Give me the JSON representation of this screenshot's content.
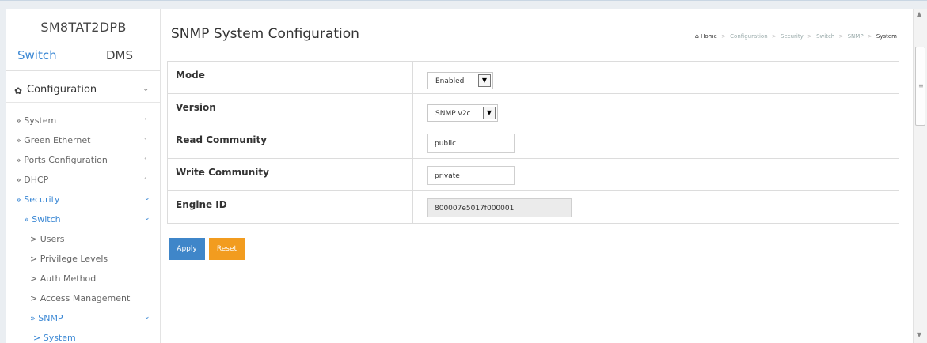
{
  "sidebar": {
    "brand": "SM8TAT2DPB",
    "tabs": [
      {
        "label": "Switch"
      },
      {
        "label": "DMS"
      }
    ],
    "section": {
      "icon": "gear-icon",
      "label": "Configuration"
    },
    "items": [
      {
        "label": "» System"
      },
      {
        "label": "» Green Ethernet"
      },
      {
        "label": "» Ports Configuration"
      },
      {
        "label": "» DHCP"
      },
      {
        "label": "» Security"
      },
      {
        "label": "» Switch"
      },
      {
        "label": "> Users"
      },
      {
        "label": "> Privilege Levels"
      },
      {
        "label": "> Auth Method"
      },
      {
        "label": "> Access Management"
      },
      {
        "label": "» SNMP"
      },
      {
        "label": "> System"
      }
    ]
  },
  "header": {
    "title": "SNMP System Configuration",
    "breadcrumb": [
      "Home",
      "Configuration",
      "Security",
      "Switch",
      "SNMP",
      "System"
    ]
  },
  "form": {
    "rows": [
      {
        "label": "Mode",
        "value": "Enabled",
        "type": "select"
      },
      {
        "label": "Version",
        "value": "SNMP v2c",
        "type": "select"
      },
      {
        "label": "Read Community",
        "value": "public",
        "type": "input"
      },
      {
        "label": "Write Community",
        "value": "private",
        "type": "input"
      },
      {
        "label": "Engine ID",
        "value": "800007e5017f000001",
        "type": "readonly"
      }
    ]
  },
  "buttons": {
    "apply": "Apply",
    "reset": "Reset"
  },
  "colors": {
    "accent": "#3a87d4",
    "apply": "#3f86c9",
    "reset": "#f29c1f"
  }
}
